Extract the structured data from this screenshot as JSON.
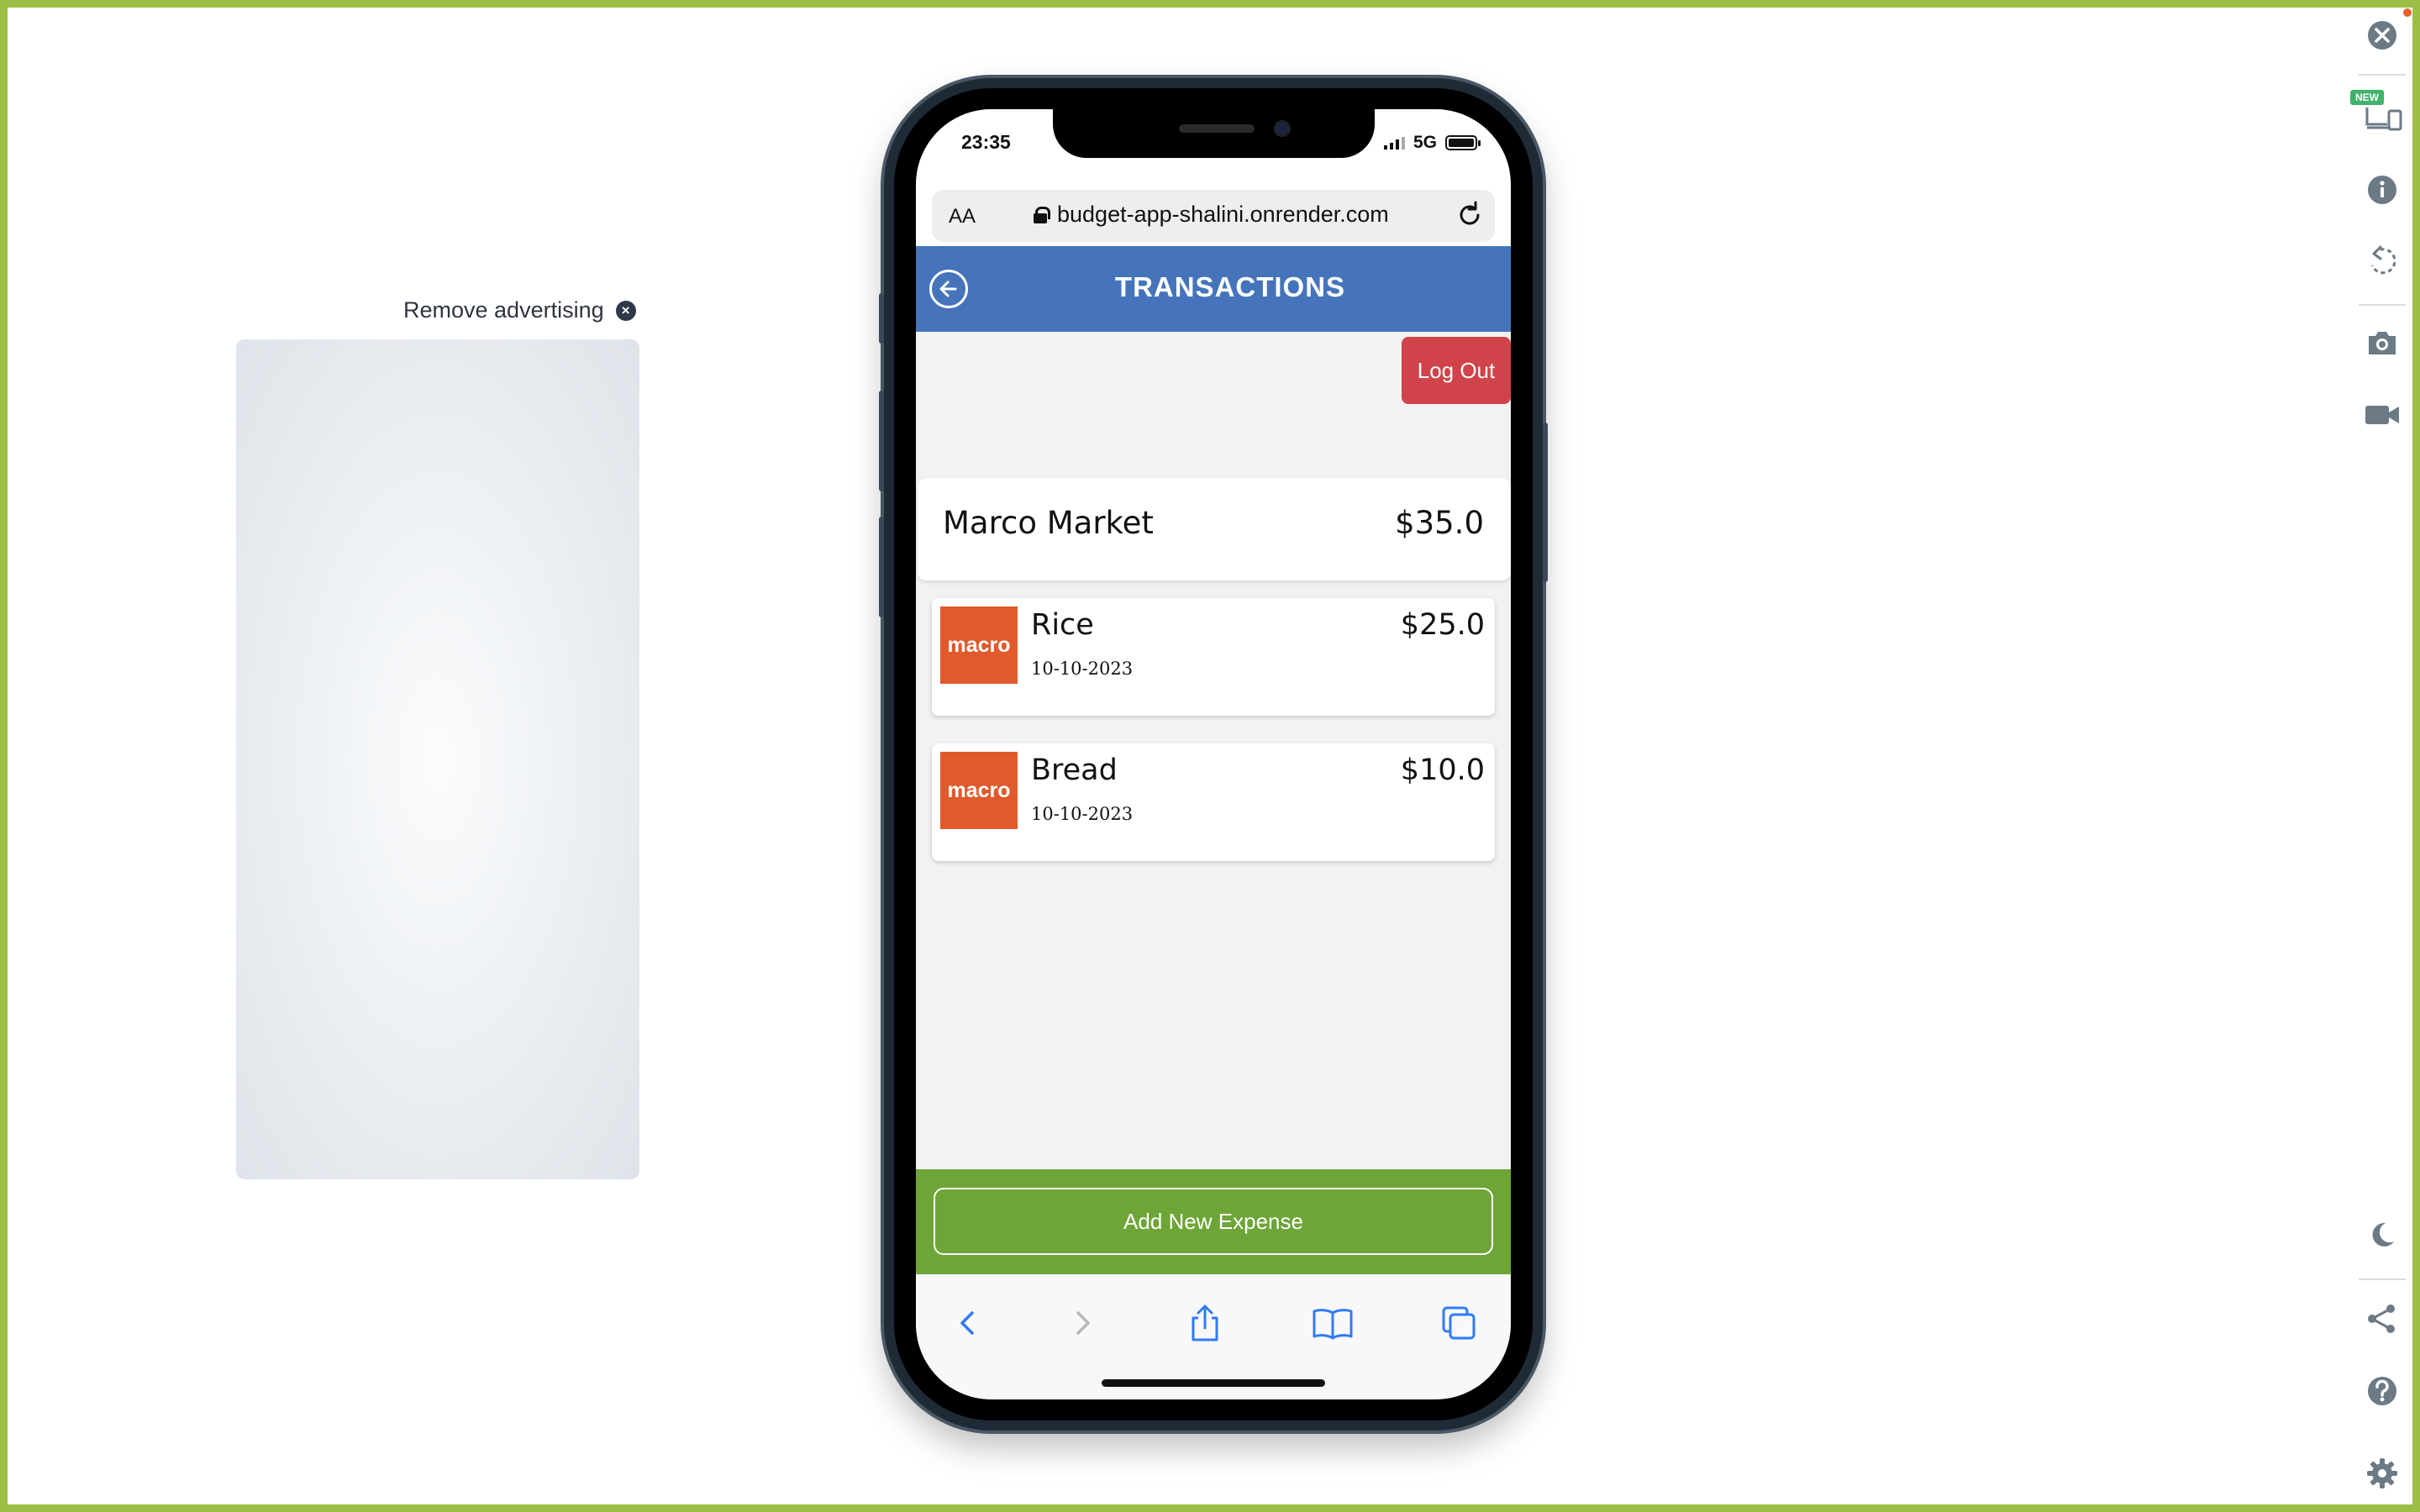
{
  "ad": {
    "remove_label": "Remove advertising"
  },
  "status_bar": {
    "time": "23:35",
    "network": "5G"
  },
  "browser": {
    "text_size_label": "AA",
    "url": "budget-app-shalini.onrender.com"
  },
  "app": {
    "title": "TRANSACTIONS",
    "logout_label": "Log Out",
    "category": {
      "name": "Marco Market",
      "total": "$35.0"
    },
    "transactions": [
      {
        "logo_text": "macro",
        "name": "Rice",
        "amount": "$25.0",
        "date": "10-10-2023"
      },
      {
        "logo_text": "macro",
        "name": "Bread",
        "amount": "$10.0",
        "date": "10-10-2023"
      }
    ],
    "add_expense_label": "Add New Expense"
  },
  "toolbar": {
    "new_badge": "NEW",
    "icons": [
      "close-icon",
      "devices-icon",
      "info-icon",
      "rotate-icon",
      "camera-icon",
      "video-icon",
      "moon-icon",
      "share-icon",
      "help-icon",
      "gear-icon"
    ]
  },
  "colors": {
    "frame": "#9dbf47",
    "header": "#4574bb",
    "logout": "#d0434a",
    "footer": "#6da537",
    "logo": "#e05a2b",
    "safari_blue": "#2f7bf5"
  }
}
